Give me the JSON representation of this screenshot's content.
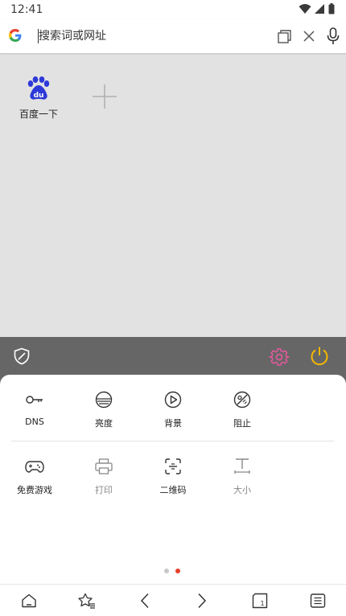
{
  "status_bar": {
    "time": "12:41"
  },
  "search": {
    "placeholder": "搜索词或网址"
  },
  "quick_links": [
    {
      "label": "百度一下"
    }
  ],
  "menu": {
    "row1": [
      {
        "label": "DNS"
      },
      {
        "label": "亮度"
      },
      {
        "label": "背景"
      },
      {
        "label": "阻止"
      }
    ],
    "row2": [
      {
        "label": "免费游戏"
      },
      {
        "label": "打印"
      },
      {
        "label": "二维码"
      },
      {
        "label": "大小"
      }
    ]
  },
  "tab_count": "1",
  "colors": {
    "toolbar_bg": "#666666",
    "gear_accent": "#e0599b",
    "power_accent": "#f5b800",
    "dot_active": "#e8402a",
    "dot_inactive": "#c8c8c8",
    "baidu_blue": "#2d39d8"
  },
  "icons": [
    "google-icon",
    "tabs-icon",
    "close-icon",
    "mic-icon",
    "baidu-icon",
    "plus-icon",
    "shield-icon",
    "gear-icon",
    "power-icon",
    "key-icon",
    "brightness-icon",
    "play-circle-icon",
    "block-icon",
    "gamepad-icon",
    "printer-icon",
    "qr-scan-icon",
    "text-size-icon",
    "home-icon",
    "bookmark-star-icon",
    "back-icon",
    "forward-icon",
    "tabs-count-icon",
    "menu-icon"
  ]
}
